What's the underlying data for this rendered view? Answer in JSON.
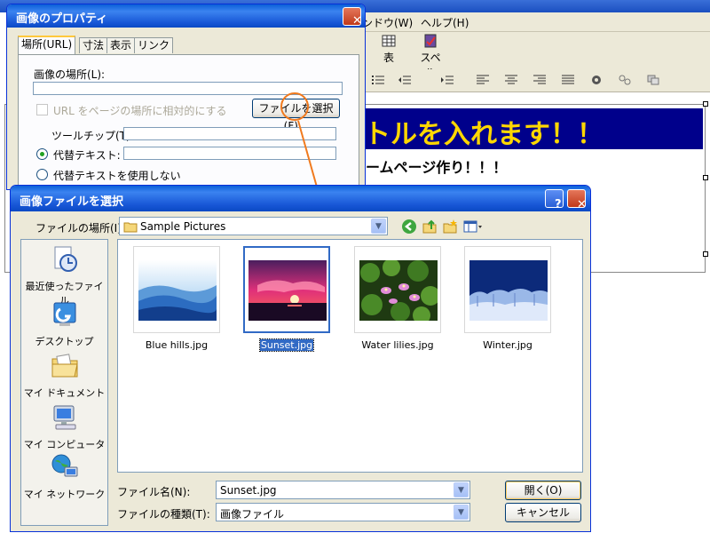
{
  "editor": {
    "menu": {
      "window": "ンドウ(W)",
      "help": "ヘルプ(H)"
    },
    "toolbar": {
      "table_label": "表",
      "spell_label": "スペル"
    },
    "headline": "トルを入れます！！",
    "subline": "ームページ作り！！！"
  },
  "prop_dialog": {
    "title": "画像のプロパティ",
    "close_glyph": "✕",
    "tabs": [
      "場所(URL)",
      "寸法",
      "表示",
      "リンク"
    ],
    "image_location_label": "画像の場所(L):",
    "image_location_value": "",
    "relative_url_label": "URL をページの場所に相対的にする",
    "choose_file_button": "ファイルを選択(F)...",
    "tooltip_label": "ツールチップ(T):",
    "alt_text_label": "代替テキスト:",
    "no_alt_text_label": "代替テキストを使用しない"
  },
  "file_dialog": {
    "title": "画像ファイルを選択",
    "help_glyph": "?",
    "close_glyph": "✕",
    "look_in_label": "ファイルの場所(I):",
    "look_in_value": "Sample Pictures",
    "places": [
      {
        "label": "最近使ったファイル",
        "icon": "recent-documents-icon"
      },
      {
        "label": "デスクトップ",
        "icon": "desktop-icon"
      },
      {
        "label": "マイ ドキュメント",
        "icon": "my-documents-icon"
      },
      {
        "label": "マイ コンピュータ",
        "icon": "my-computer-icon"
      },
      {
        "label": "マイ ネットワーク",
        "icon": "my-network-icon"
      }
    ],
    "files": [
      {
        "name": "Blue hills.jpg",
        "selected": false
      },
      {
        "name": "Sunset.jpg",
        "selected": true
      },
      {
        "name": "Water lilies.jpg",
        "selected": false
      },
      {
        "name": "Winter.jpg",
        "selected": false
      }
    ],
    "filename_label": "ファイル名(N):",
    "filename_value": "Sunset.jpg",
    "filetype_label": "ファイルの種類(T):",
    "filetype_value": "画像ファイル",
    "open_button": "開く(O)",
    "cancel_button": "キャンセル"
  },
  "colors": {
    "title_blue": "#0a5fd8",
    "selection": "#316ac5",
    "annotation": "#f07a1e",
    "headline_bg": "#00008b",
    "headline_text": "#ffd700"
  }
}
